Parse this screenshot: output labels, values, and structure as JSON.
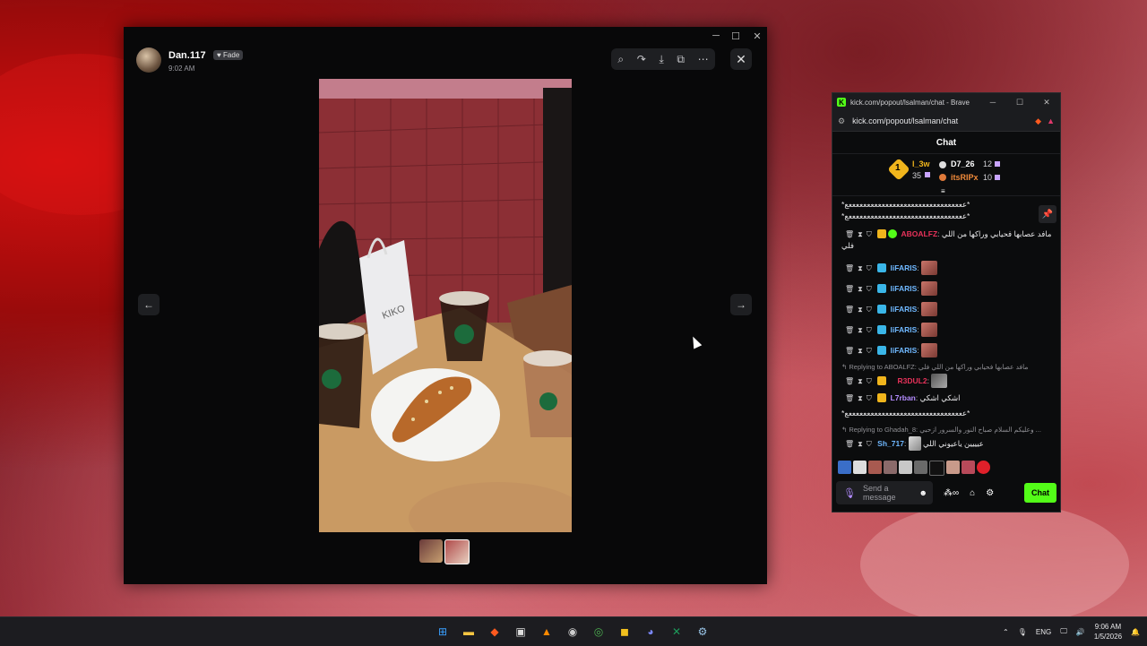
{
  "viewer": {
    "author_name": "Dan.117",
    "badge": "Fade",
    "time": "9:02 AM",
    "toolbar_icons": [
      "zoom-in-icon",
      "forward-icon",
      "download-icon",
      "open-external-icon",
      "more-icon"
    ],
    "close_icon": "✕",
    "prev_icon": "←",
    "next_icon": "→",
    "photo_text": "KIKO"
  },
  "browser": {
    "title": "kick.com/popout/lsalman/chat - Brave",
    "url": "kick.com/popout/lsalman/chat",
    "chat_title": "Chat",
    "leaderboard": {
      "rank": "1",
      "first_user": "l_3w",
      "first_value": "35",
      "second_user": "D7_26",
      "second_value": "12",
      "third_user": "itsRIPx",
      "third_value": "10"
    },
    "messages": {
      "spam1": "*ععععععععععععععععععععععععععععععععع*",
      "spam2": "*ععععععععععععععععععععععععععععععععع*",
      "m1_user": "ABOALFZ",
      "m1_text": "مافد عصابها فحيابي وراكها من اللي",
      "m1_text2": "فلي",
      "m2_user": "liFARIS",
      "m3_user": "liFARIS",
      "m4_user": "liFARIS",
      "m5_user": "liFARIS",
      "m6_user": "liFARIS",
      "reply1": "Replying to ABOALFZ: مافد عصابها فحيابي وراكها من اللي فلي",
      "m7_user": "R3DUL2",
      "m8_user": "L7rban",
      "m8_text": "اشكي اشكي",
      "spam3": "*ععععععععععععععععععععععععععععععععع*",
      "reply2": "Replying to Ghadah_8: وعليكم السلام صباح النور والسرور ازحبي ...",
      "m9_user": "Sh_717",
      "m9_text": "عيييين ياعيوني اللي"
    },
    "send_placeholder": "Send a message",
    "chat_button": "Chat",
    "accent": "#53fc18"
  },
  "taskbar": {
    "lang": "ENG",
    "time": "9:06 AM",
    "date": "1/5/2026"
  }
}
